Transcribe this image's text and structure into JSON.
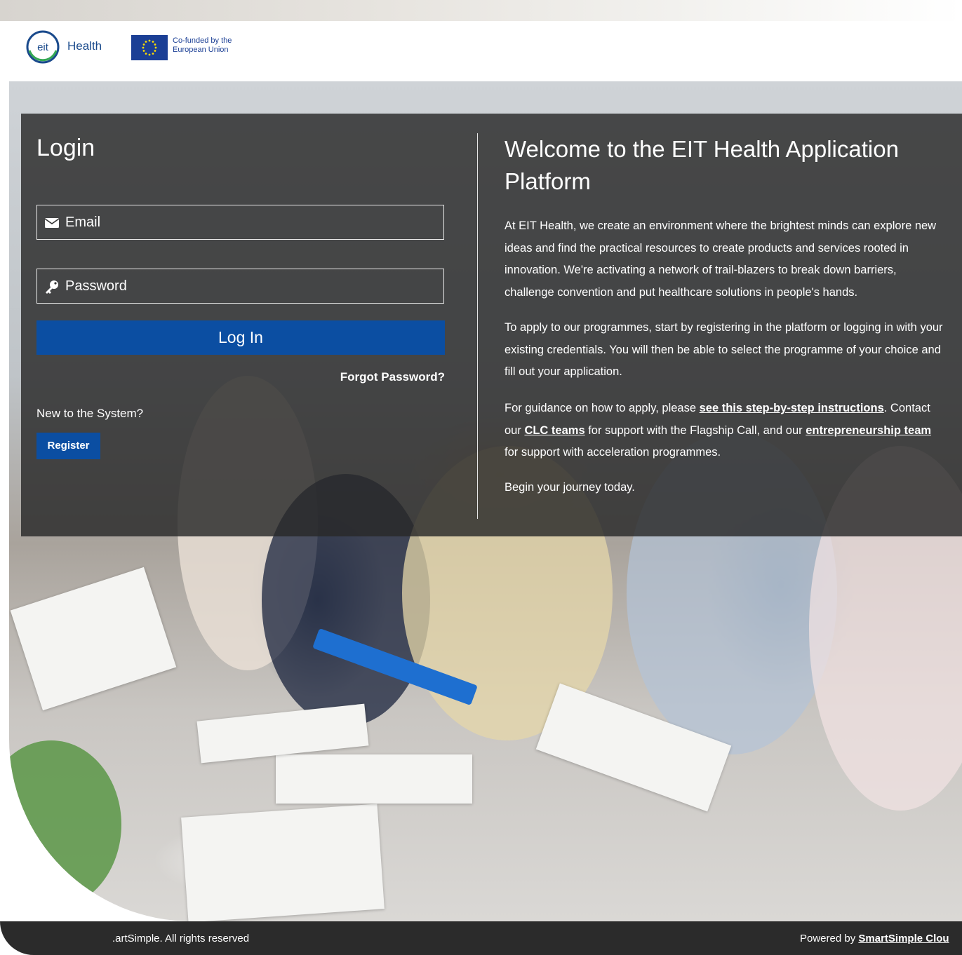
{
  "header": {
    "logo_text": "Health",
    "eu_text": "Co-funded by the European Union"
  },
  "login": {
    "title": "Login",
    "email_placeholder": "Email",
    "password_placeholder": "Password",
    "login_button": "Log In",
    "forgot_password": "Forgot Password?",
    "new_to_system": "New to the System?",
    "register_button": "Register"
  },
  "welcome": {
    "title": "Welcome to the EIT Health Application Platform",
    "para1": "At EIT Health, we create an environment where the brightest minds can explore new ideas and find the practical resources to create products and services rooted in innovation. We're activating a network of trail-blazers to break down barriers, challenge convention and put healthcare solutions in people's hands.",
    "para2": "To apply to our programmes, start by registering in the platform or logging in with your existing credentials. You will then be able to select the programme of your choice and fill out your application.",
    "para3_a": "For guidance on how to apply, please ",
    "para3_link1": "see this step-by-step instructions",
    "para3_b": ". Contact our ",
    "para3_link2": "CLC teams",
    "para3_c": " for support with the Flagship Call, and our ",
    "para3_link3": "entrepreneurship team",
    "para3_d": " for support with acceleration programmes.",
    "para4": "Begin your journey today."
  },
  "footer": {
    "copyright": "artSimple. All rights reserved.",
    "powered_by": "Powered by ",
    "powered_link": "SmartSimple Clou"
  },
  "colors": {
    "primary_button": "#0b4ea2",
    "overlay": "#282828",
    "footer": "#2b2b2b"
  }
}
